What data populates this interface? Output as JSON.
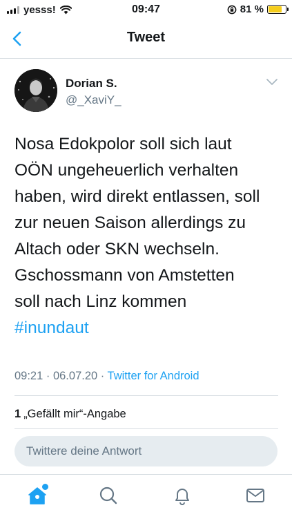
{
  "status_bar": {
    "carrier": "yesss!",
    "time": "09:47",
    "battery_percent": "81 %",
    "battery_level": 0.81,
    "battery_color": "#f5cd1c"
  },
  "nav": {
    "title": "Tweet",
    "back_icon": "chevron-left-icon"
  },
  "tweet": {
    "author_name": "Dorian S.",
    "author_handle": "@_XaviY_",
    "text_lines": [
      "Nosa Edokpolor soll sich laut",
      "OÖN ungeheuerlich verhalten",
      "haben, wird direkt entlassen, soll",
      "zur neuen Saison allerdings zu",
      "Altach oder SKN wechseln.",
      "Gschossmann von Amstetten",
      "soll nach Linz kommen"
    ],
    "hashtag": "#inundaut",
    "timestamp": "09:21 · 06.07.20 · ",
    "source": "Twitter for Android",
    "likes_count": "1",
    "likes_label": "„Gefällt mir“-Angabe"
  },
  "reply": {
    "placeholder": "Twittere deine Antwort"
  },
  "tabbar": {
    "items": [
      "home-icon",
      "search-icon",
      "notifications-bell-icon",
      "messages-envelope-icon"
    ]
  },
  "colors": {
    "accent": "#1da1f2",
    "secondary_text": "#657786",
    "divider": "#d7dde2",
    "reply_background": "#e6ecf0"
  }
}
